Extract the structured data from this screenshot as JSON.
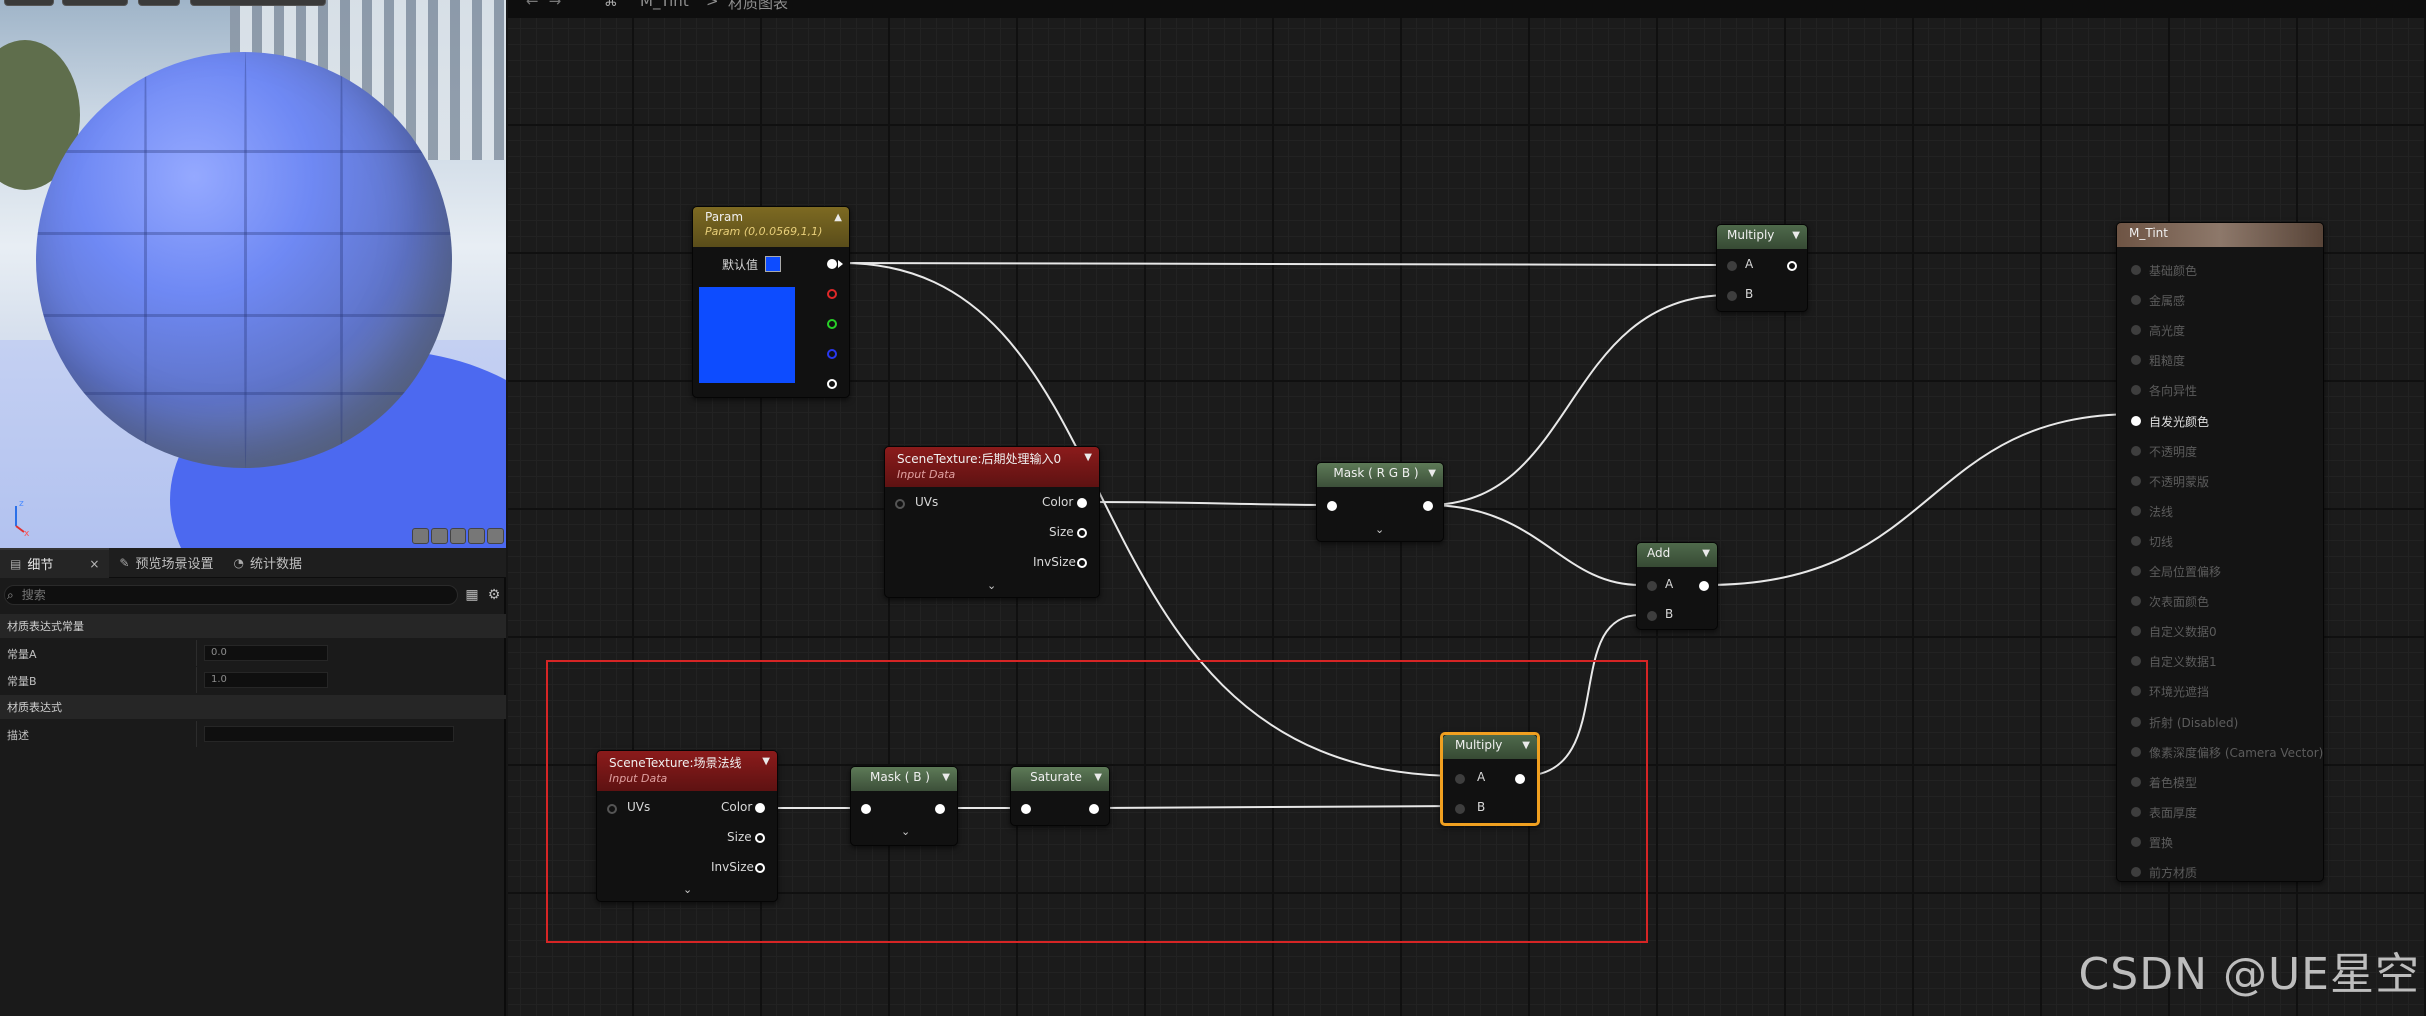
{
  "window": {
    "asset_name": "M_Tint",
    "breadcrumb_sep": ">",
    "graph_name": "材质图表"
  },
  "details_tabs": [
    {
      "label": "细节",
      "close": "×"
    },
    {
      "label": "预览场景设置"
    },
    {
      "label": "统计数据"
    }
  ],
  "search": {
    "placeholder": "搜索"
  },
  "details": {
    "section1": "材质表达式常量",
    "prop_a_label": "常量A",
    "prop_a_value": "0.0",
    "prop_b_label": "常量B",
    "prop_b_value": "1.0",
    "section2": "材质表达式",
    "desc_label": "描述",
    "desc_value": ""
  },
  "nodes": {
    "param": {
      "title": "Param",
      "subtitle": "Param (0,0.0569,1,1)",
      "default_label": "默认值",
      "color": "#0d4cff"
    },
    "scene_tex_post": {
      "title": "SceneTexture:后期处理输入0",
      "subtitle": "Input Data",
      "in_uvs": "UVs",
      "out_color": "Color",
      "out_size": "Size",
      "out_invsize": "InvSize"
    },
    "mask_rgb": {
      "title": "Mask ( R G B )"
    },
    "multiply_top": {
      "title": "Multiply",
      "in_a": "A",
      "in_b": "B"
    },
    "add": {
      "title": "Add",
      "in_a": "A",
      "in_b": "B"
    },
    "scene_tex_normal": {
      "title": "SceneTexture:场景法线",
      "subtitle": "Input Data",
      "in_uvs": "UVs",
      "out_color": "Color",
      "out_size": "Size",
      "out_invsize": "InvSize"
    },
    "mask_b": {
      "title": "Mask ( B )"
    },
    "saturate": {
      "title": "Saturate"
    },
    "multiply_sel": {
      "title": "Multiply",
      "in_a": "A",
      "in_b": "B"
    },
    "result": {
      "title": "M_Tint",
      "inputs": [
        "基础颜色",
        "金属感",
        "高光度",
        "粗糙度",
        "各向异性",
        "自发光颜色",
        "不透明度",
        "不透明蒙版",
        "法线",
        "切线",
        "全局位置偏移",
        "次表面颜色",
        "自定义数据0",
        "自定义数据1",
        "环境光遮挡",
        "折射 (Disabled)",
        "像素深度偏移 (Camera Vector)",
        "着色模型",
        "表面厚度",
        "置换",
        "前方材质"
      ],
      "active_input": "自发光颜色"
    }
  },
  "watermark": "CSDN @UE星空",
  "colors": {
    "selection_outline": "#d62525",
    "selected_node_border": "#f0a020",
    "param_color": "#0d4cff"
  }
}
